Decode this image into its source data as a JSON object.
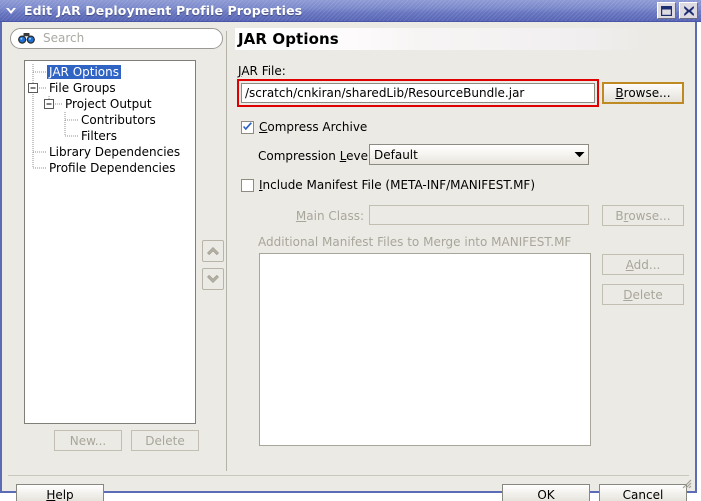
{
  "window": {
    "title": "Edit JAR Deployment Profile Properties",
    "sys_icon": "chevron-down-icon",
    "restore_label": "restore-icon",
    "close_label": "close-icon"
  },
  "sidebar": {
    "search": {
      "placeholder": "Search",
      "value": "",
      "icon": "binoculars-icon"
    },
    "tree": [
      {
        "label": "JAR Options",
        "depth": 0,
        "selected": true,
        "toggle": "none"
      },
      {
        "label": "File Groups",
        "depth": 0,
        "selected": false,
        "toggle": "minus"
      },
      {
        "label": "Project Output",
        "depth": 1,
        "selected": false,
        "toggle": "minus"
      },
      {
        "label": "Contributors",
        "depth": 2,
        "selected": false,
        "toggle": "none"
      },
      {
        "label": "Filters",
        "depth": 2,
        "selected": false,
        "toggle": "none"
      },
      {
        "label": "Library Dependencies",
        "depth": 0,
        "selected": false,
        "toggle": "none"
      },
      {
        "label": "Profile Dependencies",
        "depth": 0,
        "selected": false,
        "toggle": "none"
      }
    ],
    "reorder": {
      "up": "chevron-up-icon",
      "down": "chevron-down-icon"
    },
    "new_label": "New...",
    "delete_label": "Delete"
  },
  "main": {
    "header_title": "JAR Options",
    "jar_file": {
      "label": "JAR File:",
      "value": "/scratch/cnkiran/sharedLib/ResourceBundle.jar",
      "browse_label": "Browse...",
      "highlight_color": "#e00000"
    },
    "compress": {
      "label": "Compress Archive",
      "checked": true,
      "level_label": "Compression Level",
      "level_value": "Default"
    },
    "manifest": {
      "label": "Include Manifest File (META-INF/MANIFEST.MF)",
      "checked": false,
      "main_class_label": "Main Class:",
      "main_class_value": "",
      "main_class_browse": "Browse...",
      "additional_label": "Additional Manifest Files to Merge into MANIFEST.MF",
      "add_label": "Add...",
      "delete_label": "Delete"
    }
  },
  "footer": {
    "help_label": "Help",
    "ok_label": "OK",
    "cancel_label": "Cancel"
  }
}
